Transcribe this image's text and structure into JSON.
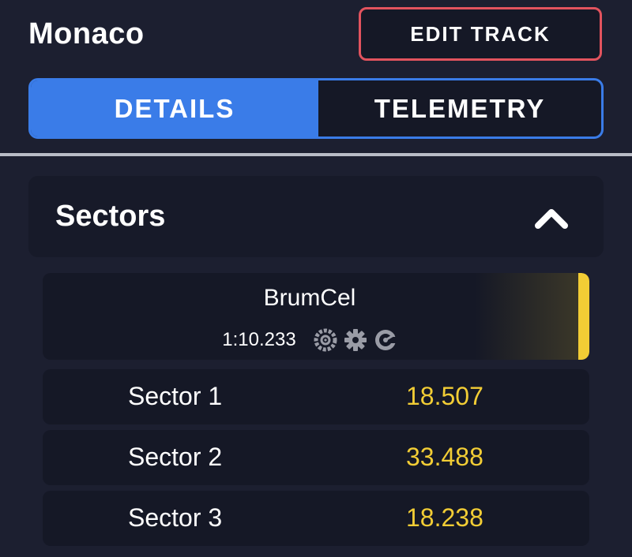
{
  "header": {
    "title": "Monaco",
    "edit_label": "EDIT TRACK"
  },
  "tabs": [
    {
      "label": "DETAILS",
      "active": true
    },
    {
      "label": "TELEMETRY",
      "active": false
    }
  ],
  "sectors_panel": {
    "title": "Sectors",
    "expanded": true,
    "icon": "chevron-up-icon"
  },
  "driver": {
    "name": "BrumCel",
    "lap_time": "1:10.233",
    "icons": [
      "tyre-icon",
      "gear-icon",
      "gauge-icon"
    ],
    "accent_color": "#f2cd35"
  },
  "sectors": [
    {
      "label": "Sector 1",
      "time": "18.507"
    },
    {
      "label": "Sector 2",
      "time": "33.488"
    },
    {
      "label": "Sector 3",
      "time": "18.238"
    }
  ],
  "colors": {
    "background": "#1c1f30",
    "accent_blue": "#3a7ce8",
    "edit_border": "#e2535e",
    "time_yellow": "#f2cd35"
  }
}
